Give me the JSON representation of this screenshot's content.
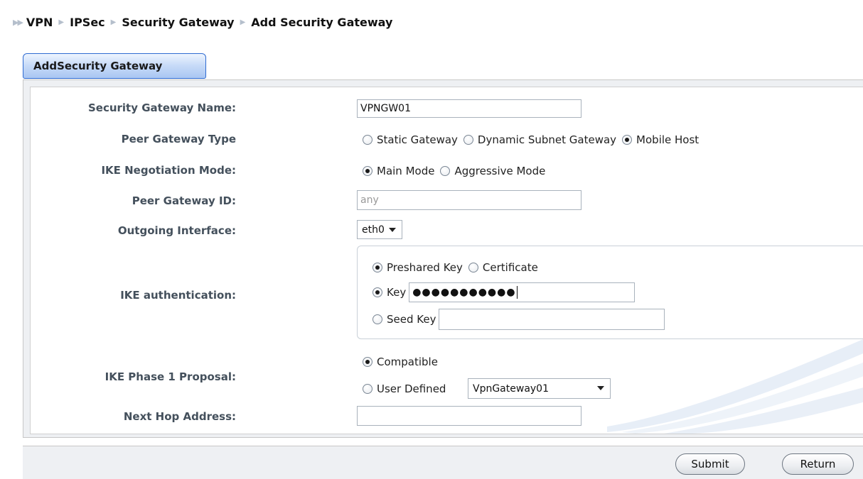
{
  "breadcrumb": {
    "items": [
      "VPN",
      "IPSec",
      "Security Gateway",
      "Add Security Gateway"
    ]
  },
  "tab": {
    "label": "AddSecurity Gateway"
  },
  "form": {
    "gateway_name": {
      "label": "Security Gateway Name:",
      "value": "VPNGW01"
    },
    "peer_type": {
      "label": "Peer Gateway Type",
      "options": [
        "Static Gateway",
        "Dynamic Subnet Gateway",
        "Mobile Host"
      ],
      "selected": "Mobile Host"
    },
    "ike_mode": {
      "label": "IKE Negotiation Mode:",
      "options": [
        "Main Mode",
        "Aggressive Mode"
      ],
      "selected": "Main Mode"
    },
    "peer_id": {
      "label": "Peer Gateway ID:",
      "value": "any"
    },
    "outgoing": {
      "label": "Outgoing Interface:",
      "value": "eth0"
    },
    "ike_auth": {
      "label": "IKE authentication:",
      "method_options": [
        "Preshared Key",
        "Certificate"
      ],
      "method_selected": "Preshared Key",
      "key_label": "Key",
      "key_value": "●●●●●●●●●●●",
      "seed_label": "Seed Key",
      "seed_value": ""
    },
    "phase1": {
      "label": "IKE Phase 1 Proposal:",
      "options": [
        "Compatible",
        "User Defined"
      ],
      "selected": "Compatible",
      "proposal_value": "VpnGateway01"
    },
    "next_hop": {
      "label": "Next Hop Address:",
      "value": ""
    }
  },
  "buttons": {
    "submit": "Submit",
    "return": "Return"
  },
  "colors": {
    "tab_border": "#2f6bd1",
    "label_text": "#44505c",
    "panel_bg": "#eef0f3"
  }
}
